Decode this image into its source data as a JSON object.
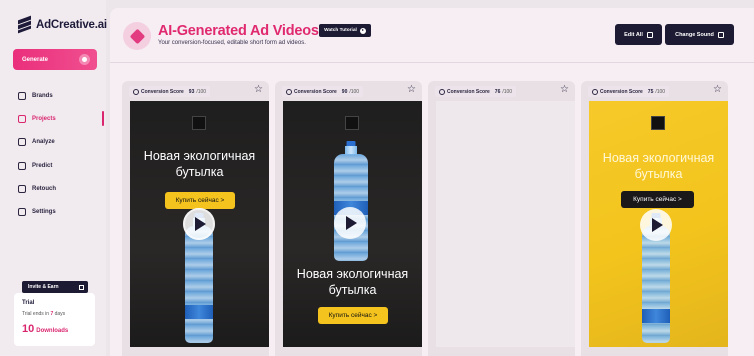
{
  "brand": {
    "name": "AdCreative.ai"
  },
  "sidebar": {
    "generate_label": "Generate",
    "items": [
      {
        "label": "Brands",
        "icon": "brands-icon",
        "active": false
      },
      {
        "label": "Projects",
        "icon": "projects-icon",
        "active": true
      },
      {
        "label": "Analyze",
        "icon": "analyze-icon",
        "active": false
      },
      {
        "label": "Predict",
        "icon": "predict-icon",
        "active": false
      },
      {
        "label": "Retouch",
        "icon": "retouch-icon",
        "active": false
      },
      {
        "label": "Settings",
        "icon": "settings-icon",
        "active": false
      }
    ],
    "invite_label": "Invite & Earn",
    "trial": {
      "title": "Trial",
      "ends_prefix": "Trial ends in",
      "days_value": "7",
      "days_suffix": "days",
      "downloads_count": "10",
      "downloads_label": "Downloads"
    }
  },
  "header": {
    "title": "AI-Generated Ad Videos",
    "subtitle": "Your conversion-focused, editable short form ad videos.",
    "watch_label": "Watch Tutorial",
    "edit_all_label": "Edit All",
    "change_sound_label": "Change Sound"
  },
  "cards": [
    {
      "score_label": "Conversion Score",
      "score": "93",
      "score_max": "/100",
      "headline": "Новая экологичная бутылка",
      "cta": "Купить сейчас >"
    },
    {
      "score_label": "Conversion Score",
      "score": "90",
      "score_max": "/100",
      "headline": "Новая экологичная бутылка",
      "cta": "Купить сейчас >"
    },
    {
      "score_label": "Conversion Score",
      "score": "76",
      "score_max": "/100"
    },
    {
      "score_label": "Conversion Score",
      "score": "75",
      "score_max": "/100",
      "headline": "Новая экологичная бутылка",
      "cta": "Купить сейчас >"
    }
  ],
  "colors": {
    "accent": "#e0296f",
    "dark_button": "#1d1a33",
    "cta_yellow": "#f4c31e"
  }
}
